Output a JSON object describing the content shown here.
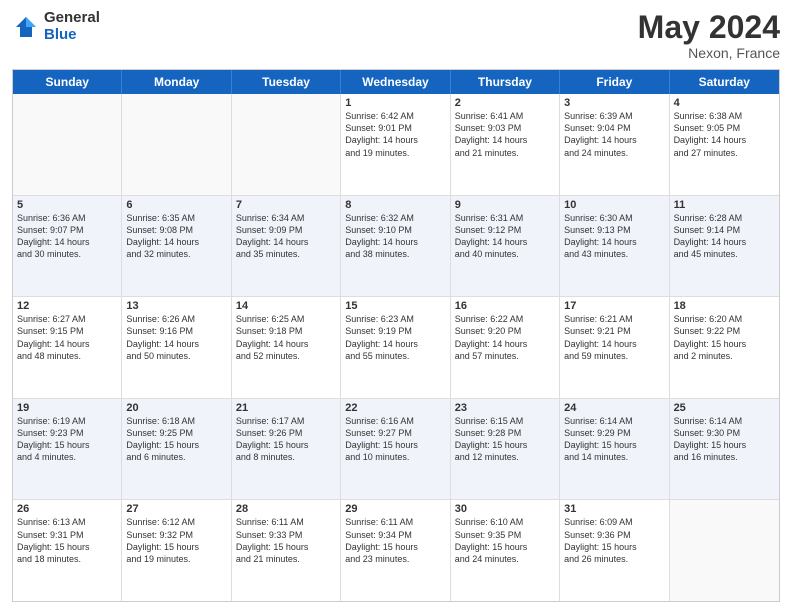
{
  "logo": {
    "general": "General",
    "blue": "Blue"
  },
  "title": "May 2024",
  "location": "Nexon, France",
  "days": [
    "Sunday",
    "Monday",
    "Tuesday",
    "Wednesday",
    "Thursday",
    "Friday",
    "Saturday"
  ],
  "rows": [
    [
      {
        "day": "",
        "text": ""
      },
      {
        "day": "",
        "text": ""
      },
      {
        "day": "",
        "text": ""
      },
      {
        "day": "1",
        "text": "Sunrise: 6:42 AM\nSunset: 9:01 PM\nDaylight: 14 hours\nand 19 minutes."
      },
      {
        "day": "2",
        "text": "Sunrise: 6:41 AM\nSunset: 9:03 PM\nDaylight: 14 hours\nand 21 minutes."
      },
      {
        "day": "3",
        "text": "Sunrise: 6:39 AM\nSunset: 9:04 PM\nDaylight: 14 hours\nand 24 minutes."
      },
      {
        "day": "4",
        "text": "Sunrise: 6:38 AM\nSunset: 9:05 PM\nDaylight: 14 hours\nand 27 minutes."
      }
    ],
    [
      {
        "day": "5",
        "text": "Sunrise: 6:36 AM\nSunset: 9:07 PM\nDaylight: 14 hours\nand 30 minutes."
      },
      {
        "day": "6",
        "text": "Sunrise: 6:35 AM\nSunset: 9:08 PM\nDaylight: 14 hours\nand 32 minutes."
      },
      {
        "day": "7",
        "text": "Sunrise: 6:34 AM\nSunset: 9:09 PM\nDaylight: 14 hours\nand 35 minutes."
      },
      {
        "day": "8",
        "text": "Sunrise: 6:32 AM\nSunset: 9:10 PM\nDaylight: 14 hours\nand 38 minutes."
      },
      {
        "day": "9",
        "text": "Sunrise: 6:31 AM\nSunset: 9:12 PM\nDaylight: 14 hours\nand 40 minutes."
      },
      {
        "day": "10",
        "text": "Sunrise: 6:30 AM\nSunset: 9:13 PM\nDaylight: 14 hours\nand 43 minutes."
      },
      {
        "day": "11",
        "text": "Sunrise: 6:28 AM\nSunset: 9:14 PM\nDaylight: 14 hours\nand 45 minutes."
      }
    ],
    [
      {
        "day": "12",
        "text": "Sunrise: 6:27 AM\nSunset: 9:15 PM\nDaylight: 14 hours\nand 48 minutes."
      },
      {
        "day": "13",
        "text": "Sunrise: 6:26 AM\nSunset: 9:16 PM\nDaylight: 14 hours\nand 50 minutes."
      },
      {
        "day": "14",
        "text": "Sunrise: 6:25 AM\nSunset: 9:18 PM\nDaylight: 14 hours\nand 52 minutes."
      },
      {
        "day": "15",
        "text": "Sunrise: 6:23 AM\nSunset: 9:19 PM\nDaylight: 14 hours\nand 55 minutes."
      },
      {
        "day": "16",
        "text": "Sunrise: 6:22 AM\nSunset: 9:20 PM\nDaylight: 14 hours\nand 57 minutes."
      },
      {
        "day": "17",
        "text": "Sunrise: 6:21 AM\nSunset: 9:21 PM\nDaylight: 14 hours\nand 59 minutes."
      },
      {
        "day": "18",
        "text": "Sunrise: 6:20 AM\nSunset: 9:22 PM\nDaylight: 15 hours\nand 2 minutes."
      }
    ],
    [
      {
        "day": "19",
        "text": "Sunrise: 6:19 AM\nSunset: 9:23 PM\nDaylight: 15 hours\nand 4 minutes."
      },
      {
        "day": "20",
        "text": "Sunrise: 6:18 AM\nSunset: 9:25 PM\nDaylight: 15 hours\nand 6 minutes."
      },
      {
        "day": "21",
        "text": "Sunrise: 6:17 AM\nSunset: 9:26 PM\nDaylight: 15 hours\nand 8 minutes."
      },
      {
        "day": "22",
        "text": "Sunrise: 6:16 AM\nSunset: 9:27 PM\nDaylight: 15 hours\nand 10 minutes."
      },
      {
        "day": "23",
        "text": "Sunrise: 6:15 AM\nSunset: 9:28 PM\nDaylight: 15 hours\nand 12 minutes."
      },
      {
        "day": "24",
        "text": "Sunrise: 6:14 AM\nSunset: 9:29 PM\nDaylight: 15 hours\nand 14 minutes."
      },
      {
        "day": "25",
        "text": "Sunrise: 6:14 AM\nSunset: 9:30 PM\nDaylight: 15 hours\nand 16 minutes."
      }
    ],
    [
      {
        "day": "26",
        "text": "Sunrise: 6:13 AM\nSunset: 9:31 PM\nDaylight: 15 hours\nand 18 minutes."
      },
      {
        "day": "27",
        "text": "Sunrise: 6:12 AM\nSunset: 9:32 PM\nDaylight: 15 hours\nand 19 minutes."
      },
      {
        "day": "28",
        "text": "Sunrise: 6:11 AM\nSunset: 9:33 PM\nDaylight: 15 hours\nand 21 minutes."
      },
      {
        "day": "29",
        "text": "Sunrise: 6:11 AM\nSunset: 9:34 PM\nDaylight: 15 hours\nand 23 minutes."
      },
      {
        "day": "30",
        "text": "Sunrise: 6:10 AM\nSunset: 9:35 PM\nDaylight: 15 hours\nand 24 minutes."
      },
      {
        "day": "31",
        "text": "Sunrise: 6:09 AM\nSunset: 9:36 PM\nDaylight: 15 hours\nand 26 minutes."
      },
      {
        "day": "",
        "text": ""
      }
    ]
  ]
}
